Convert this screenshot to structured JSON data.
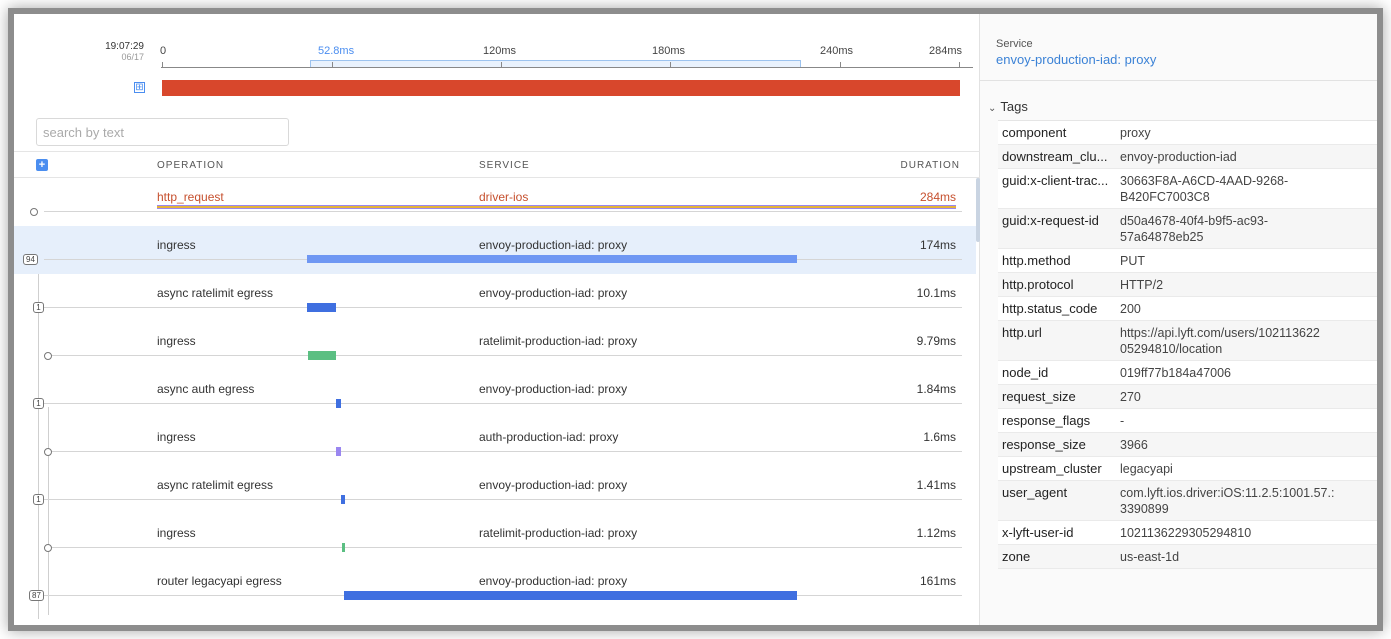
{
  "timeline": {
    "clock_time": "19:07:29",
    "clock_date": "06/17",
    "ticks": [
      "0",
      "52.8ms",
      "120ms",
      "180ms",
      "240ms",
      "284ms"
    ],
    "expand_glyph": "⊞"
  },
  "search": {
    "placeholder": "search by text",
    "value": ""
  },
  "table": {
    "expand_all_glyph": "+",
    "headers": {
      "operation": "OPERATION",
      "service": "SERVICE",
      "duration": "DURATION"
    }
  },
  "spans": [
    {
      "operation": "http_request",
      "service": "driver-ios",
      "duration": "284ms",
      "node": "",
      "bar_color": "#e5b338",
      "root": true
    },
    {
      "operation": "ingress",
      "service": "envoy-production-iad: proxy",
      "duration": "174ms",
      "node": "94",
      "bar_color": "#6f97f3",
      "selected": true
    },
    {
      "operation": "async ratelimit egress",
      "service": "envoy-production-iad: proxy",
      "duration": "10.1ms",
      "node": "1",
      "bar_color": "#3f6fe0"
    },
    {
      "operation": "ingress",
      "service": "ratelimit-production-iad: proxy",
      "duration": "9.79ms",
      "node": "",
      "bar_color": "#5bbf82"
    },
    {
      "operation": "async auth egress",
      "service": "envoy-production-iad: proxy",
      "duration": "1.84ms",
      "node": "1",
      "bar_color": "#3f6fe0"
    },
    {
      "operation": "ingress",
      "service": "auth-production-iad: proxy",
      "duration": "1.6ms",
      "node": "",
      "bar_color": "#9a86f0"
    },
    {
      "operation": "async ratelimit egress",
      "service": "envoy-production-iad: proxy",
      "duration": "1.41ms",
      "node": "1",
      "bar_color": "#3f6fe0"
    },
    {
      "operation": "ingress",
      "service": "ratelimit-production-iad: proxy",
      "duration": "1.12ms",
      "node": "",
      "bar_color": "#5bbf82"
    },
    {
      "operation": "router legacyapi egress",
      "service": "envoy-production-iad: proxy",
      "duration": "161ms",
      "node": "87",
      "bar_color": "#3f6fe0"
    }
  ],
  "detail": {
    "service_label": "Service",
    "service_value": "envoy-production-iad: proxy",
    "tags_label": "Tags",
    "tags_chevron": "⌄",
    "tags": [
      {
        "key": "component",
        "value": "proxy"
      },
      {
        "key": "downstream_clu...",
        "value": "envoy-production-iad"
      },
      {
        "key": "guid:x-client-trac...",
        "value": "30663F8A-A6CD-4AAD-9268-\nB420FC7003C8"
      },
      {
        "key": "guid:x-request-id",
        "value": "d50a4678-40f4-b9f5-ac93-\n57a64878eb25"
      },
      {
        "key": "http.method",
        "value": "PUT"
      },
      {
        "key": "http.protocol",
        "value": "HTTP/2"
      },
      {
        "key": "http.status_code",
        "value": "200"
      },
      {
        "key": "http.url",
        "value": "https://api.lyft.com/users/102113622\n05294810/location"
      },
      {
        "key": "node_id",
        "value": "019ff77b184a47006"
      },
      {
        "key": "request_size",
        "value": "270"
      },
      {
        "key": "response_flags",
        "value": "-"
      },
      {
        "key": "response_size",
        "value": "3966"
      },
      {
        "key": "upstream_cluster",
        "value": "legacyapi"
      },
      {
        "key": "user_agent",
        "value": "com.lyft.ios.driver:iOS:11.2.5:1001.57.:\n3390899"
      },
      {
        "key": "x-lyft-user-id",
        "value": "1021136229305294810"
      },
      {
        "key": "zone",
        "value": "us-east-1d"
      }
    ]
  }
}
